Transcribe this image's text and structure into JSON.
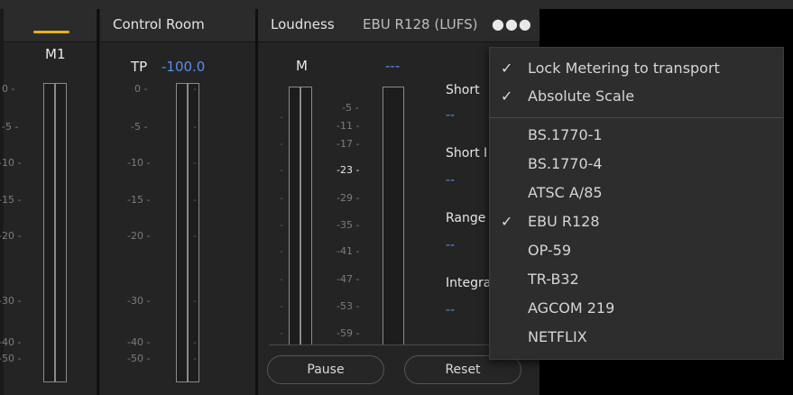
{
  "meters": {
    "m1": {
      "label": "M1",
      "scale": [
        "0 -",
        "-5 -",
        "-10 -",
        "-15 -",
        "-20 -",
        "-30 -",
        "-40 -",
        "-50 -"
      ]
    },
    "control_room": {
      "title": "Control Room",
      "tp_label": "TP",
      "tp_value": "-100.0",
      "scale": [
        "0 -",
        "-5 -",
        "-10 -",
        "-15 -",
        "-20 -",
        "-30 -",
        "-40 -",
        "-50 -"
      ]
    },
    "loudness": {
      "title": "Loudness",
      "standard": "EBU R128 (LUFS)",
      "more_icon": "more-dots-icon",
      "m_label": "M",
      "m_value": "---",
      "scale": [
        "-5 -",
        "-11 -",
        "-17 -",
        "-23 -",
        "-29 -",
        "-35 -",
        "-41 -",
        "-47 -",
        "-53 -",
        "-59 -"
      ],
      "stats": [
        {
          "label": "Short",
          "value": "--"
        },
        {
          "label": "Short I",
          "value": "--"
        },
        {
          "label": "Range",
          "value": "--"
        },
        {
          "label": "Integra",
          "value": "--"
        }
      ],
      "pause_label": "Pause",
      "reset_label": "Reset"
    }
  },
  "menu": {
    "options": [
      {
        "label": "Lock Metering to transport",
        "checked": true
      },
      {
        "label": "Absolute Scale",
        "checked": true
      }
    ],
    "standards": [
      {
        "label": "BS.1770-1",
        "checked": false
      },
      {
        "label": "BS.1770-4",
        "checked": false
      },
      {
        "label": "ATSC A/85",
        "checked": false
      },
      {
        "label": "EBU R128",
        "checked": true
      },
      {
        "label": "OP-59",
        "checked": false
      },
      {
        "label": "TR-B32",
        "checked": false
      },
      {
        "label": "AGCOM 219",
        "checked": false
      },
      {
        "label": "NETFLIX",
        "checked": false
      }
    ],
    "check_glyph": "✓"
  },
  "colors": {
    "accent_yellow": "#e6b21b",
    "value_blue": "#5a8cf0"
  }
}
